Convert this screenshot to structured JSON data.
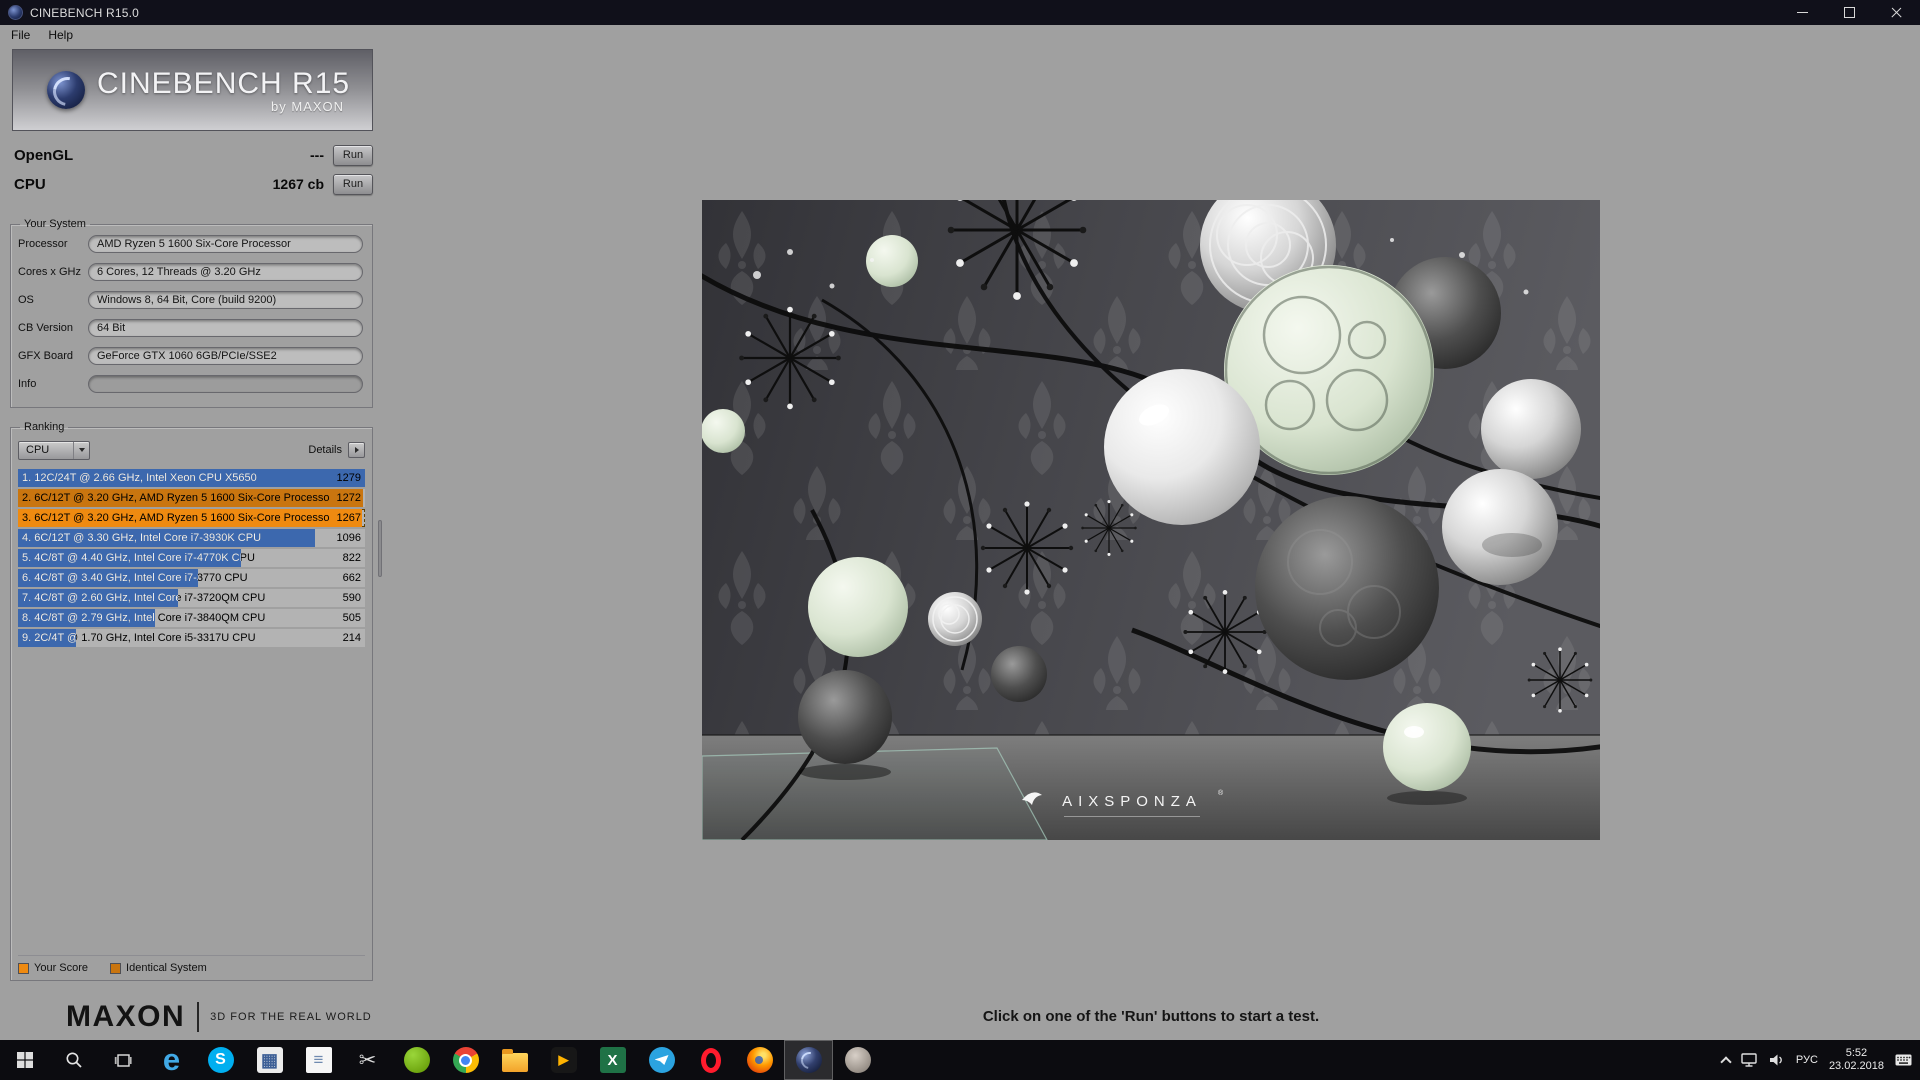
{
  "window": {
    "title": "CINEBENCH R15.0",
    "menu": [
      "File",
      "Help"
    ]
  },
  "branding": {
    "app_name": "CINEBENCH R15",
    "byline": "by MAXON",
    "maxon_logo": "MAXON",
    "maxon_tagline": "3D FOR THE REAL WORLD"
  },
  "benchmarks": {
    "opengl": {
      "label": "OpenGL",
      "value": "---",
      "run_label": "Run"
    },
    "cpu": {
      "label": "CPU",
      "value": "1267 cb",
      "run_label": "Run"
    }
  },
  "your_system": {
    "title": "Your System",
    "fields": [
      {
        "label": "Processor",
        "value": "AMD Ryzen 5 1600 Six-Core Processor"
      },
      {
        "label": "Cores x GHz",
        "value": "6 Cores, 12 Threads @ 3.20 GHz"
      },
      {
        "label": "OS",
        "value": "Windows 8, 64 Bit, Core (build 9200)"
      },
      {
        "label": "CB Version",
        "value": "64 Bit"
      },
      {
        "label": "GFX Board",
        "value": "GeForce GTX 1060 6GB/PCIe/SSE2"
      },
      {
        "label": "Info",
        "value": ""
      }
    ]
  },
  "ranking": {
    "title": "Ranking",
    "filter_value": "CPU",
    "details_label": "Details",
    "colors": {
      "reference": "#3c68ae",
      "yours": "#ef8a10",
      "identical": "#c9750f"
    },
    "rows": [
      {
        "rank": 1,
        "label": "1. 12C/24T @ 2.66 GHz, Intel Xeon CPU X5650",
        "score": "1279",
        "type": "reference",
        "bar_pct": 100
      },
      {
        "rank": 2,
        "label": "2. 6C/12T @ 3.20 GHz, AMD Ryzen 5 1600 Six-Core Processo",
        "score": "1272",
        "type": "identical",
        "bar_pct": 99.5
      },
      {
        "rank": 3,
        "label": "3. 6C/12T @ 3.20 GHz, AMD Ryzen 5 1600 Six-Core Processo",
        "score": "1267",
        "type": "yours",
        "bar_pct": 99.1
      },
      {
        "rank": 4,
        "label": "4. 6C/12T @ 3.30 GHz,  Intel Core i7-3930K CPU",
        "score": "1096",
        "type": "reference",
        "bar_pct": 85.7
      },
      {
        "rank": 5,
        "label": "5. 4C/8T @ 4.40 GHz, Intel Core i7-4770K CPU",
        "score": "822",
        "type": "reference",
        "bar_pct": 64.3
      },
      {
        "rank": 6,
        "label": "6. 4C/8T @ 3.40 GHz,  Intel Core i7-3770 CPU",
        "score": "662",
        "type": "reference",
        "bar_pct": 51.8
      },
      {
        "rank": 7,
        "label": "7. 4C/8T @ 2.60 GHz, Intel Core i7-3720QM CPU",
        "score": "590",
        "type": "reference",
        "bar_pct": 46.1
      },
      {
        "rank": 8,
        "label": "8. 4C/8T @ 2.79 GHz,  Intel Core i7-3840QM CPU",
        "score": "505",
        "type": "reference",
        "bar_pct": 39.5
      },
      {
        "rank": 9,
        "label": "9. 2C/4T @ 1.70 GHz,  Intel Core i5-3317U CPU",
        "score": "214",
        "type": "reference",
        "bar_pct": 16.7
      }
    ],
    "legend": [
      {
        "label": "Your Score",
        "color": "#ef8a10"
      },
      {
        "label": "Identical System",
        "color": "#c9750f"
      }
    ]
  },
  "viewport": {
    "hint": "Click on one of the 'Run' buttons to start a test.",
    "scene_logo": "AIXSPONZA",
    "scene_logo_reg": "®"
  },
  "taskbar": {
    "apps": [
      {
        "name": "edge",
        "glyph": "e"
      },
      {
        "name": "skype",
        "glyph": "S"
      },
      {
        "name": "calculator",
        "glyph": "▦"
      },
      {
        "name": "notepad",
        "glyph": "≡"
      },
      {
        "name": "snipping-tool",
        "glyph": "✂"
      },
      {
        "name": "geforce-experience",
        "glyph": ""
      },
      {
        "name": "chrome",
        "glyph": ""
      },
      {
        "name": "file-explorer",
        "glyph": ""
      },
      {
        "name": "aimp",
        "glyph": "▶"
      },
      {
        "name": "excel",
        "glyph": "X"
      },
      {
        "name": "telegram",
        "glyph": ""
      },
      {
        "name": "opera",
        "glyph": ""
      },
      {
        "name": "firefox",
        "glyph": ""
      },
      {
        "name": "cinebench",
        "glyph": "",
        "active": true
      },
      {
        "name": "gimp",
        "glyph": ""
      }
    ],
    "tray": {
      "language": "РУС",
      "time": "5:52",
      "date": "23.02.2018"
    }
  }
}
